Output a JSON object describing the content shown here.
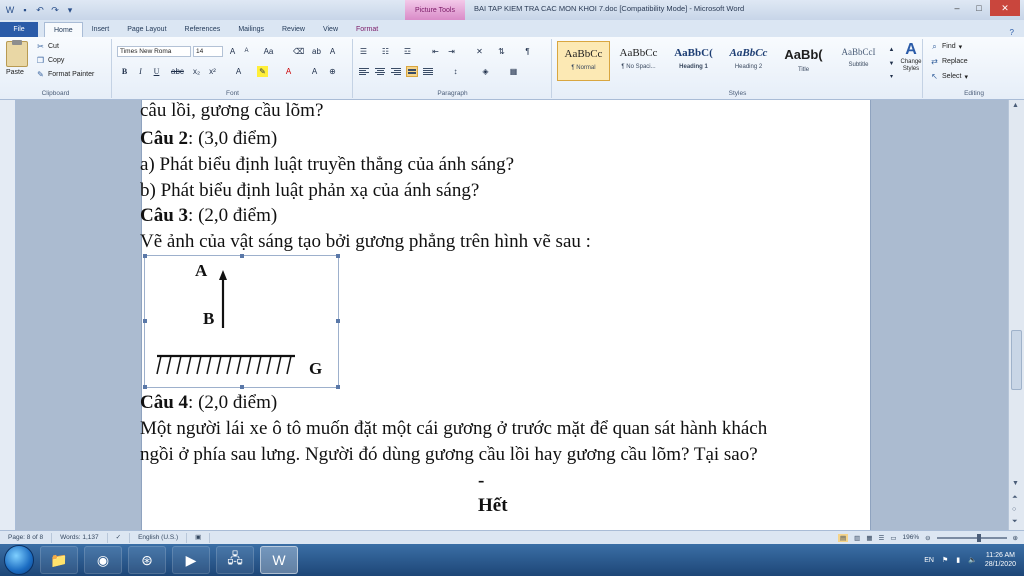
{
  "window": {
    "title": "BAI TAP KIEM TRA CAC MON KHOI 7.doc [Compatibility Mode] - Microsoft Word",
    "context_tab": "Picture Tools"
  },
  "tabs": [
    "File",
    "Home",
    "Insert",
    "Page Layout",
    "References",
    "Mailings",
    "Review",
    "View",
    "Format"
  ],
  "ribbon": {
    "clipboard": {
      "paste": "Paste",
      "cut": "Cut",
      "copy": "Copy",
      "format_painter": "Format Painter",
      "label": "Clipboard"
    },
    "font": {
      "name": "Times New Roma",
      "size": "14",
      "label": "Font"
    },
    "paragraph": {
      "label": "Paragraph"
    },
    "styles": {
      "label": "Styles",
      "items": [
        {
          "sample": "AaBbCc",
          "name": "¶ Normal"
        },
        {
          "sample": "AaBbCc",
          "name": "¶ No Spaci..."
        },
        {
          "sample": "AaBbC(",
          "name": "Heading 1"
        },
        {
          "sample": "AaBbCc",
          "name": "Heading 2"
        },
        {
          "sample": "AaBb(",
          "name": "Title"
        },
        {
          "sample": "AaBbCcI",
          "name": "Subtitle"
        }
      ],
      "change_styles": "Change Styles"
    },
    "editing": {
      "find": "Find",
      "replace": "Replace",
      "select": "Select",
      "label": "Editing"
    }
  },
  "document": {
    "line0": "câu lồi, gương cầu lõm?",
    "q2_bold": "Câu 2",
    "q2_rest": ": (3,0 điểm)",
    "q2a": "a) Phát biểu định luật truyền thẳng của ánh sáng?",
    "q2b": "b) Phát biểu định luật phản xạ của ánh sáng?",
    "q3_bold": "Câu 3",
    "q3_rest": ": (2,0 điểm)",
    "q3_text": "Vẽ ảnh của vật sáng tạo bởi gương phẳng trên hình vẽ sau :",
    "figure": {
      "label_a": "A",
      "label_b": "B",
      "label_g": "G"
    },
    "q4_bold": "Câu 4",
    "q4_rest": ": (2,0 điểm)",
    "q4_line1": "Một người lái xe ô tô muốn đặt một cái gương ở trước mặt để quan sát hành khách",
    "q4_line2": "ngồi ở phía sau lưng. Người đó dùng gương cầu lồi hay gương cầu lõm? Tại sao?",
    "end": "- Hết -"
  },
  "statusbar": {
    "page": "Page: 8 of 8",
    "words": "Words: 1,137",
    "language": "English (U.S.)",
    "zoom": "196%"
  },
  "taskbar": {
    "language": "EN",
    "time": "11:26 AM",
    "date": "28/1/2020"
  }
}
